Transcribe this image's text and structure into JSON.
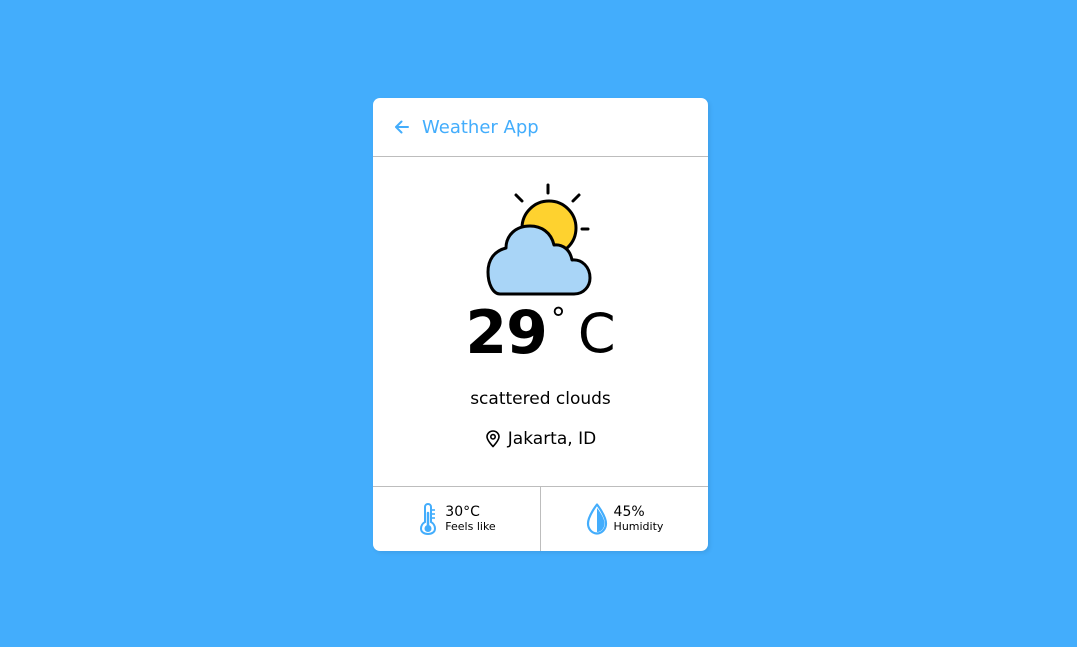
{
  "header": {
    "title": "Weather App"
  },
  "weather": {
    "temperature": "29",
    "degree_symbol": "°",
    "unit": "C",
    "description": "scattered clouds",
    "location": "Jakarta, ID",
    "icon": "partly-cloudy-icon"
  },
  "details": {
    "feels_like": {
      "value": "30°C",
      "label": "Feels like",
      "icon": "thermometer-icon"
    },
    "humidity": {
      "value": "45%",
      "label": "Humidity",
      "icon": "water-drop-icon"
    }
  },
  "colors": {
    "background": "#43adfc",
    "accent": "#43adfc",
    "sun": "#fed22f",
    "cloud": "#a9d5f7"
  }
}
